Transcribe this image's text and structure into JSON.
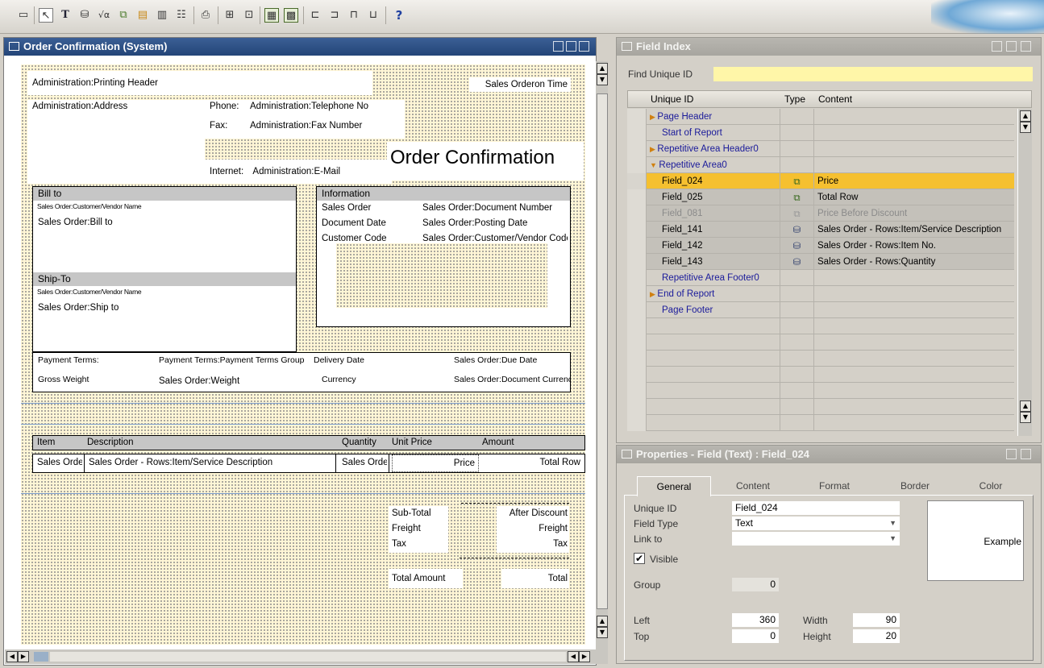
{
  "toolbar": {
    "buttons": [
      "save-icon",
      "select-icon",
      "text-icon",
      "database-icon",
      "formula-icon",
      "field-icon",
      "picture-icon",
      "barcode-icon",
      "table-icon",
      "print-icon",
      "align-icon",
      "grid-icon",
      "snap-icon",
      "show-grid-icon",
      "help-icon"
    ],
    "help_label": "?"
  },
  "designer": {
    "title": "Order Confirmation (System)",
    "header": {
      "printing_header": "Administration:Printing Header",
      "sales_order_time": "Sales Orderon Time",
      "address": "Administration:Address",
      "phone_label": "Phone:",
      "phone_value": "Administration:Telephone No",
      "fax_label": "Fax:",
      "fax_value": "Administration:Fax Number",
      "internet_label": "Internet:",
      "internet_value": "Administration:E-Mail",
      "doc_title": "Order Confirmation"
    },
    "bill_to": {
      "header": "Bill to",
      "name": "Sales Order:Customer/Vendor Name",
      "address": "Sales Order:Bill to"
    },
    "ship_to": {
      "header": "Ship-To",
      "name": "Sales Order:Customer/Vendor Name",
      "address": "Sales Order:Ship to"
    },
    "information": {
      "header": "Information",
      "rows": [
        {
          "label": "Sales Order",
          "value": "Sales Order:Document Number"
        },
        {
          "label": "Document Date",
          "value": "Sales Order:Posting Date"
        },
        {
          "label": "Customer Code",
          "value": "Sales Order:Customer/Vendor Code"
        }
      ]
    },
    "terms": {
      "payment_terms_label": "Payment Terms:",
      "payment_terms_value": "Payment Terms:Payment Terms Group",
      "delivery_label": "Delivery Date",
      "delivery_value": "Sales Order:Due Date",
      "gross_weight_label": "Gross Weight",
      "gross_weight_value": "Sales Order:Weight",
      "currency_label": "Currency",
      "currency_value": "Sales Order:Document Currency"
    },
    "items": {
      "headers": [
        "Item",
        "Description",
        "Quantity",
        "Unit Price",
        "Amount"
      ],
      "row": [
        "Sales Order",
        "Sales Order - Rows:Item/Service Description",
        "Sales Order",
        "Price",
        "Total Row"
      ]
    },
    "totals": {
      "subtotal": "Sub-Total",
      "after_discount": "After Discount",
      "freight": "Freight",
      "freight_value": "Freight",
      "tax": "Tax",
      "tax_value": "Tax",
      "total_amount": "Total Amount",
      "total_value": "Total"
    }
  },
  "field_index": {
    "title": "Field Index",
    "find_label": "Find Unique ID",
    "find_value": "",
    "columns": [
      "Unique ID",
      "Type",
      "Content"
    ],
    "rows": [
      {
        "id": "Page Header",
        "type": "",
        "content": "",
        "kind": "section",
        "marker": "▶"
      },
      {
        "id": "Start of Report",
        "type": "",
        "content": "",
        "kind": "section",
        "marker": ""
      },
      {
        "id": "Repetitive Area Header0",
        "type": "",
        "content": "",
        "kind": "section",
        "marker": "▶"
      },
      {
        "id": "Repetitive Area0",
        "type": "",
        "content": "",
        "kind": "section",
        "marker": "▼"
      },
      {
        "id": "Field_024",
        "type": "formula",
        "content": "Price",
        "kind": "selected",
        "marker": ""
      },
      {
        "id": "Field_025",
        "type": "formula",
        "content": "Total Row",
        "kind": "field",
        "marker": ""
      },
      {
        "id": "Field_081",
        "type": "formula",
        "content": "Price Before Discount",
        "kind": "disabled",
        "marker": ""
      },
      {
        "id": "Field_141",
        "type": "database",
        "content": "Sales Order - Rows:Item/Service Description",
        "kind": "field",
        "marker": ""
      },
      {
        "id": "Field_142",
        "type": "database",
        "content": "Sales Order - Rows:Item No.",
        "kind": "field",
        "marker": ""
      },
      {
        "id": "Field_143",
        "type": "database",
        "content": "Sales Order - Rows:Quantity",
        "kind": "field",
        "marker": ""
      },
      {
        "id": "Repetitive Area Footer0",
        "type": "",
        "content": "",
        "kind": "section",
        "marker": ""
      },
      {
        "id": "End of Report",
        "type": "",
        "content": "",
        "kind": "section",
        "marker": "▶"
      },
      {
        "id": "Page Footer",
        "type": "",
        "content": "",
        "kind": "section",
        "marker": ""
      }
    ]
  },
  "properties": {
    "title": "Properties - Field (Text) : Field_024",
    "tabs": [
      "General",
      "Content",
      "Format",
      "Border",
      "Color"
    ],
    "unique_id_label": "Unique ID",
    "unique_id": "Field_024",
    "field_type_label": "Field Type",
    "field_type": "Text",
    "link_to_label": "Link to",
    "link_to": "",
    "visible_label": "Visible",
    "visible": true,
    "group_label": "Group",
    "group": "0",
    "left_label": "Left",
    "left": "360",
    "width_label": "Width",
    "width": "90",
    "top_label": "Top",
    "top": "0",
    "height_label": "Height",
    "height": "20",
    "example_label": "Example"
  },
  "colors": {
    "title_active": "#2b4e84",
    "selected_row": "#f5c030",
    "find_field": "#fff6a8",
    "canvas_dots": "#fff6d6"
  }
}
